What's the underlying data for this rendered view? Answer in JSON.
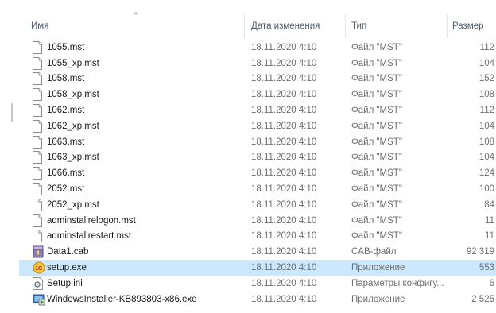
{
  "columns": {
    "name": "Имя",
    "date": "Дата изменения",
    "type": "Тип",
    "size": "Размер"
  },
  "files": [
    {
      "name": "1055.mst",
      "date": "18.11.2020 4:10",
      "type": "Файл \"MST\"",
      "size": "112",
      "icon": "blank-file-icon"
    },
    {
      "name": "1055_xp.mst",
      "date": "18.11.2020 4:10",
      "type": "Файл \"MST\"",
      "size": "104",
      "icon": "blank-file-icon"
    },
    {
      "name": "1058.mst",
      "date": "18.11.2020 4:10",
      "type": "Файл \"MST\"",
      "size": "152",
      "icon": "blank-file-icon"
    },
    {
      "name": "1058_xp.mst",
      "date": "18.11.2020 4:10",
      "type": "Файл \"MST\"",
      "size": "108",
      "icon": "blank-file-icon"
    },
    {
      "name": "1062.mst",
      "date": "18.11.2020 4:10",
      "type": "Файл \"MST\"",
      "size": "112",
      "icon": "blank-file-icon"
    },
    {
      "name": "1062_xp.mst",
      "date": "18.11.2020 4:10",
      "type": "Файл \"MST\"",
      "size": "104",
      "icon": "blank-file-icon"
    },
    {
      "name": "1063.mst",
      "date": "18.11.2020 4:10",
      "type": "Файл \"MST\"",
      "size": "108",
      "icon": "blank-file-icon"
    },
    {
      "name": "1063_xp.mst",
      "date": "18.11.2020 4:10",
      "type": "Файл \"MST\"",
      "size": "104",
      "icon": "blank-file-icon"
    },
    {
      "name": "1066.mst",
      "date": "18.11.2020 4:10",
      "type": "Файл \"MST\"",
      "size": "124",
      "icon": "blank-file-icon"
    },
    {
      "name": "2052.mst",
      "date": "18.11.2020 4:10",
      "type": "Файл \"MST\"",
      "size": "100",
      "icon": "blank-file-icon"
    },
    {
      "name": "2052_xp.mst",
      "date": "18.11.2020 4:10",
      "type": "Файл \"MST\"",
      "size": "84",
      "icon": "blank-file-icon"
    },
    {
      "name": "adminstallrelogon.mst",
      "date": "18.11.2020 4:10",
      "type": "Файл \"MST\"",
      "size": "11",
      "icon": "blank-file-icon"
    },
    {
      "name": "adminstallrestart.mst",
      "date": "18.11.2020 4:10",
      "type": "Файл \"MST\"",
      "size": "11",
      "icon": "blank-file-icon"
    },
    {
      "name": "Data1.cab",
      "date": "18.11.2020 4:10",
      "type": "CAB-файл",
      "size": "92 319",
      "icon": "cab-archive-icon"
    },
    {
      "name": "setup.exe",
      "date": "18.11.2020 4:10",
      "type": "Приложение",
      "size": "553",
      "icon": "1c-setup-icon",
      "selected": true
    },
    {
      "name": "Setup.ini",
      "date": "18.11.2020 4:10",
      "type": "Параметры конфигу...",
      "size": "6",
      "icon": "ini-settings-icon"
    },
    {
      "name": "WindowsInstaller-KB893803-x86.exe",
      "date": "18.11.2020 4:10",
      "type": "Приложение",
      "size": "2 525",
      "icon": "windows-installer-icon"
    }
  ],
  "colors": {
    "selected_row": "#cce8ff",
    "header_text": "#4c5b6e",
    "secondary_text": "#6d6d6d"
  }
}
